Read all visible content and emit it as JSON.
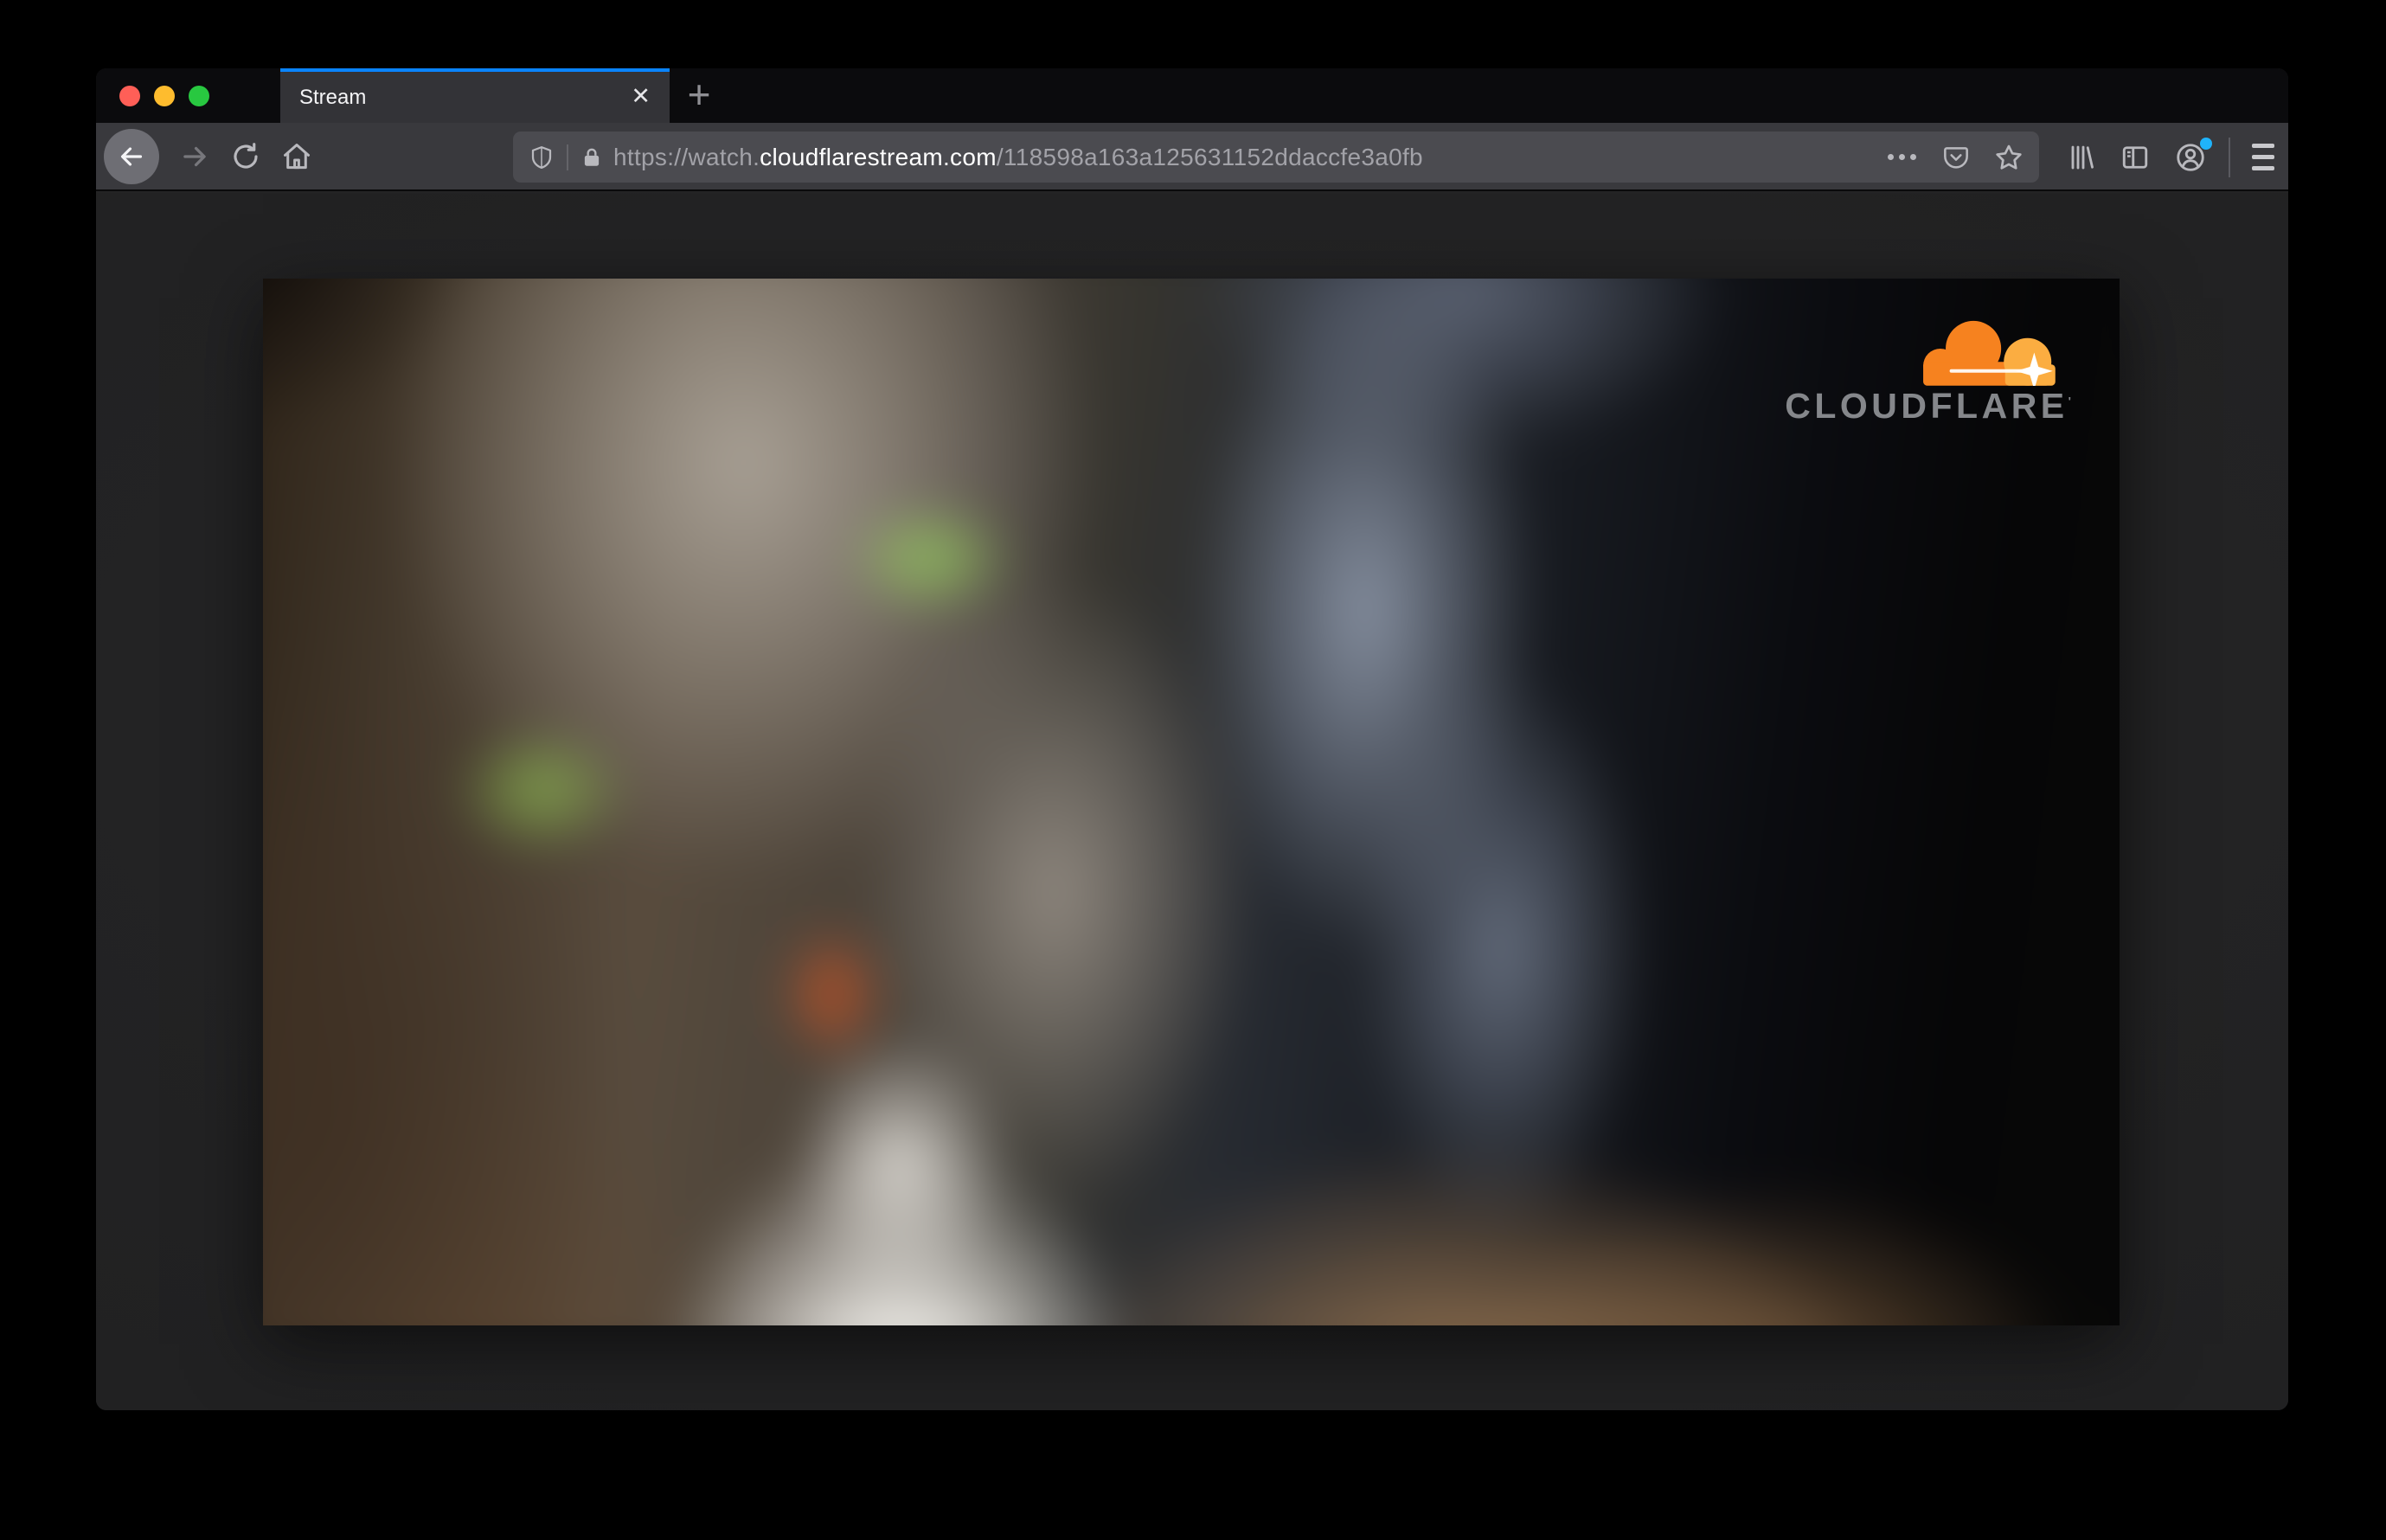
{
  "browser": {
    "tab_bar": {
      "active_tab": {
        "title": "Stream",
        "close_glyph": "✕"
      },
      "new_tab_glyph": "+"
    },
    "toolbar": {
      "url_bar": {
        "scheme_subdomain": "https://watch.",
        "domain": "cloudflarestream.com",
        "path": "/118598a163a125631152ddaccfe3a0fb"
      }
    }
  },
  "page": {
    "video_player": {
      "brand_wordmark": "CLOUDFLARE",
      "brand_trademark": "'"
    }
  },
  "colors": {
    "accent_blue": "#0a84ff",
    "notification_dot_blue": "#1fb3fb",
    "cloudflare_orange": "#f6821f",
    "cloudflare_orange_light": "#fbad41",
    "traffic_close_red": "#ff5f57",
    "traffic_minimize_yellow": "#febc2e",
    "traffic_zoom_green": "#28c840",
    "toolbar_gray": "#39393d",
    "urlbar_gray": "#4b4b50",
    "tabbar_black": "#0b0b0d"
  }
}
